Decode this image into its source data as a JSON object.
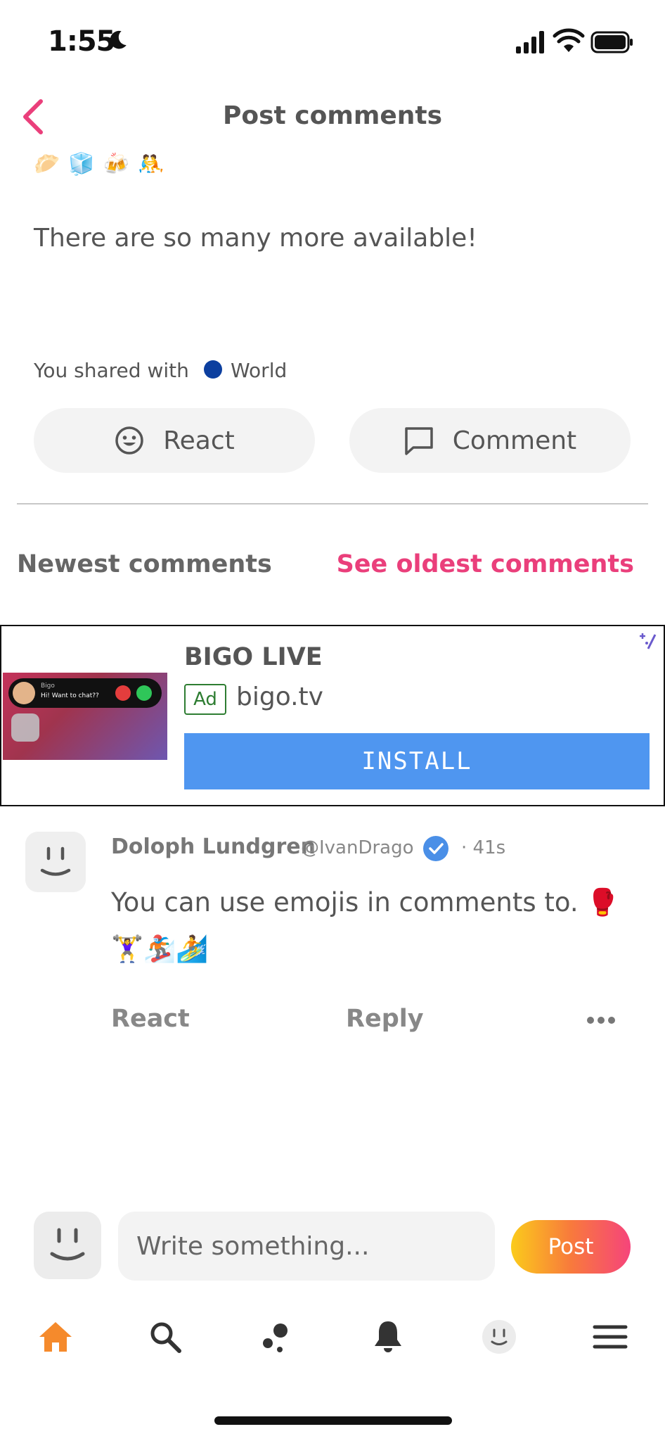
{
  "status_bar": {
    "time": "1:55"
  },
  "header": {
    "title": "Post comments"
  },
  "post": {
    "emojis": "🥟🧊🍻🤼",
    "text": "There are so many more available!",
    "shared_with_label": "You shared with",
    "audience": "World",
    "audience_color": "#0c3f9f",
    "react_label": "React",
    "comment_label": "Comment"
  },
  "comments_header": {
    "newest_label": "Newest comments",
    "oldest_link": "See oldest comments"
  },
  "ad": {
    "call_name": "Bigo",
    "call_text": "Hi! Want to chat??",
    "brand": "BIGO LIVE",
    "badge": "Ad",
    "domain": "bigo.tv",
    "cta": "INSTALL",
    "cta_color": "#4f96f0"
  },
  "comment": {
    "author": "Doloph Lundgren",
    "handle": "@IvanDrago",
    "time": "· 41s",
    "text": "You can use emojis in comments to. 🥊 🏋️‍♀️🏂🏄",
    "react_label": "React",
    "reply_label": "Reply"
  },
  "composer": {
    "placeholder": "Write something...",
    "post_label": "Post"
  },
  "bottom_nav": {
    "items": [
      "home-icon",
      "search-icon",
      "dots-icon",
      "bell-icon",
      "profile-icon",
      "menu-icon"
    ],
    "active_color": "#f58a2c"
  },
  "colors": {
    "accent_pink": "#ea3f7b",
    "text_gray": "#555555"
  }
}
